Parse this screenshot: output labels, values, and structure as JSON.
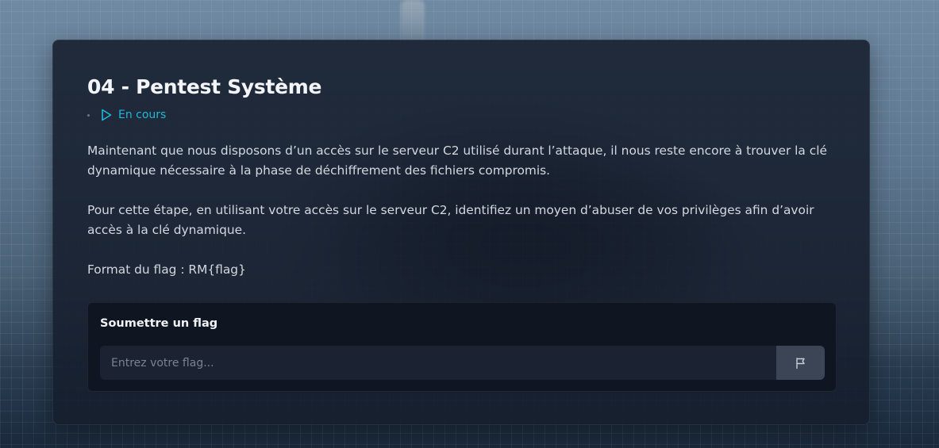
{
  "challenge": {
    "title": "04 - Pentest Système",
    "status_label": "En cours",
    "description": [
      "Maintenant que nous disposons d’un accès sur le serveur C2 utilisé durant l’attaque, il nous reste encore à trouver la clé dynamique nécessaire à la phase de déchiffrement des fichiers compromis.",
      "Pour cette étape, en utilisant votre accès sur le serveur C2, identifiez un moyen d’abuser de vos privilèges afin d’avoir accès à la clé dynamique.",
      "Format du flag : RM{flag}"
    ]
  },
  "flag_form": {
    "heading": "Soumettre un flag",
    "input_value": "",
    "input_placeholder": "Entrez votre flag...",
    "submit_icon": "flag-icon"
  },
  "colors": {
    "accent": "#1fb8d6",
    "panel": "#161e2c",
    "button": "#3b4555"
  }
}
